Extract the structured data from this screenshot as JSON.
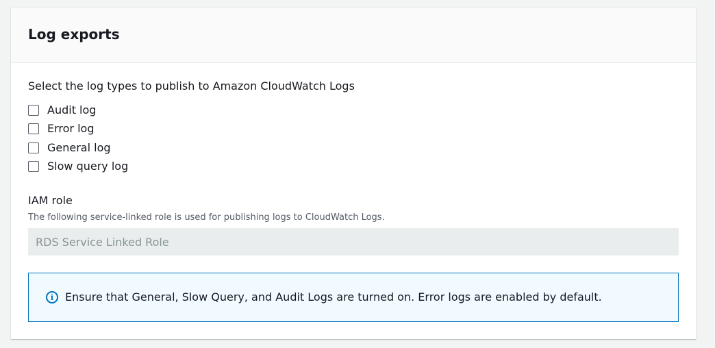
{
  "panel": {
    "title": "Log exports"
  },
  "log_types": {
    "label": "Select the log types to publish to Amazon CloudWatch Logs",
    "items": [
      {
        "label": "Audit log",
        "checked": false
      },
      {
        "label": "Error log",
        "checked": false
      },
      {
        "label": "General log",
        "checked": false
      },
      {
        "label": "Slow query log",
        "checked": false
      }
    ]
  },
  "iam_role": {
    "label": "IAM role",
    "description": "The following service-linked role is used for publishing logs to CloudWatch Logs.",
    "value": "RDS Service Linked Role"
  },
  "info": {
    "icon": "info-icon",
    "icon_glyph": "i",
    "message": "Ensure that General, Slow Query, and Audit Logs are turned on. Error logs are enabled by default."
  },
  "colors": {
    "accent": "#0073bb",
    "info_background": "#f1faff"
  }
}
